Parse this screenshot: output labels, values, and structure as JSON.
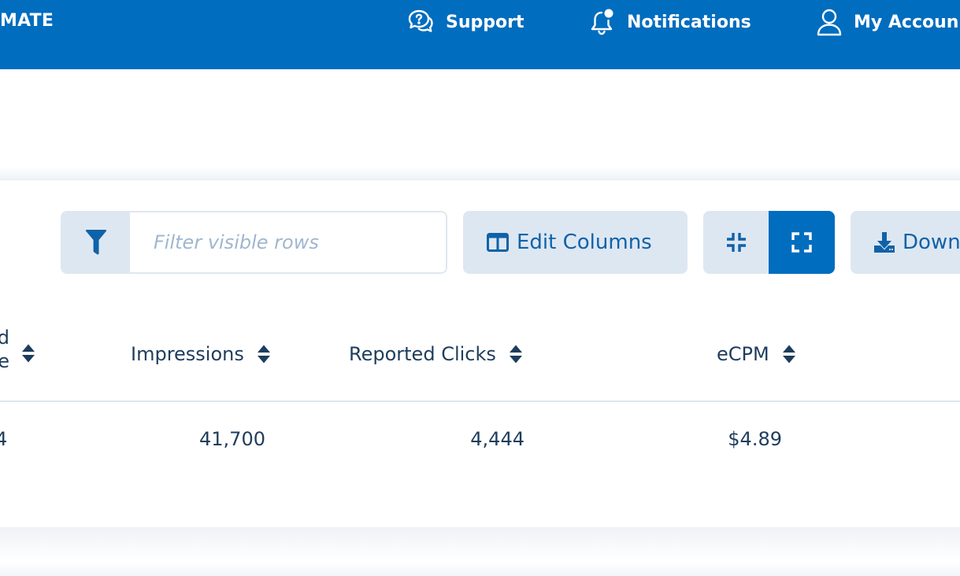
{
  "header": {
    "brand": "MATE",
    "support_label": "Support",
    "notifications_label": "Notifications",
    "account_label": "My Accoun"
  },
  "toolbar": {
    "filter_placeholder": "Filter visible rows",
    "filter_value": "",
    "edit_columns_label": "Edit Columns",
    "download_label": "Down"
  },
  "table": {
    "columns": [
      {
        "partial_lines": [
          "d",
          "e"
        ]
      },
      {
        "label": "Impressions"
      },
      {
        "label": "Reported Clicks"
      },
      {
        "label": "eCPM"
      }
    ],
    "rows": [
      {
        "partial_value": "4",
        "impressions": "41,700",
        "reported_clicks": "4,444",
        "ecpm": "$4.89"
      }
    ]
  },
  "colors": {
    "header_bg": "#006dbf",
    "button_bg": "#dde7f2",
    "button_text": "#0f62a8",
    "active_button_bg": "#006dbf",
    "table_text": "#1e3d5c",
    "placeholder_text": "#9fb7cf"
  },
  "icons": {
    "support": "support-chat-icon",
    "notifications": "bell-icon",
    "account": "user-icon",
    "filter": "filter-funnel-icon",
    "edit_columns": "columns-icon",
    "compress": "compress-icon",
    "expand": "expand-icon",
    "download": "download-icon",
    "sort": "sort-icon"
  }
}
